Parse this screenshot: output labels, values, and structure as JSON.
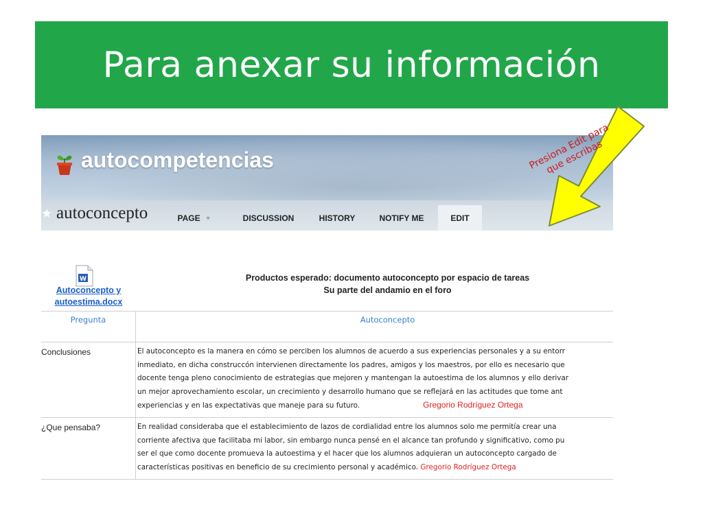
{
  "slide": {
    "title": "Para anexar su información"
  },
  "wiki": {
    "site_name": "autocompetencias",
    "page_name": "autoconcepto",
    "tabs": [
      {
        "label": "PAGE",
        "has_dropdown": true
      },
      {
        "label": "DISCUSSION"
      },
      {
        "label": "HISTORY"
      },
      {
        "label": "NOTIFY ME"
      },
      {
        "label": "EDIT",
        "active": true
      }
    ]
  },
  "callout": {
    "line1": "Presiona Edit para",
    "line2": "que escribas",
    "fill": "#ffff00"
  },
  "document": {
    "file_line1": "Autoconcepto y",
    "file_line2": "autoestima.docx",
    "title_line1": "Productos esperado: documento autoconcepto por espacio de tareas",
    "title_line2": "Su parte del andamio en el foro"
  },
  "table": {
    "headers": [
      "Pregunta",
      "Autoconcepto"
    ],
    "rows": [
      {
        "label": "Conclusiones",
        "lines": [
          "El autoconcepto es la manera en cómo se perciben los alumnos de acuerdo a sus experiencias personales y a su entorr",
          "inmediato, en dicha construccón intervienen directamente los padres, amigos y los maestros, por ello es necesario que",
          "docente tenga pleno conocimiento de estrategias que mejoren y mantengan la autoestima de los alumnos y ello derivar",
          "un mejor aprovechamiento escolar, un crecimiento y desarrollo humano que se reflejará en las actitudes que tome ant",
          "experiencias y en las expectativas que maneje para su futuro."
        ],
        "signature": "Gregorio Rodríguez Ortega"
      },
      {
        "label": "¿Que pensaba?",
        "lines": [
          "En realidad consideraba que el establecimiento de lazos de cordialidad entre los alumnos solo me permitía crear una",
          "corriente afectiva que facilitaba mi labor, sin embargo nunca pensé en el alcance tan profundo y significativo, como pu",
          "ser el que como docente promueva la autoestima y el hacer que los alumnos adquieran un autoconcepto cargado de",
          "características positivas en beneficio de su crecimiento personal y académico."
        ],
        "signature": "Gregorio Rodríguez Ortega"
      }
    ]
  },
  "colors": {
    "title_bar": "#22a64a",
    "link": "#1a5ec9",
    "signature": "#e02020"
  }
}
